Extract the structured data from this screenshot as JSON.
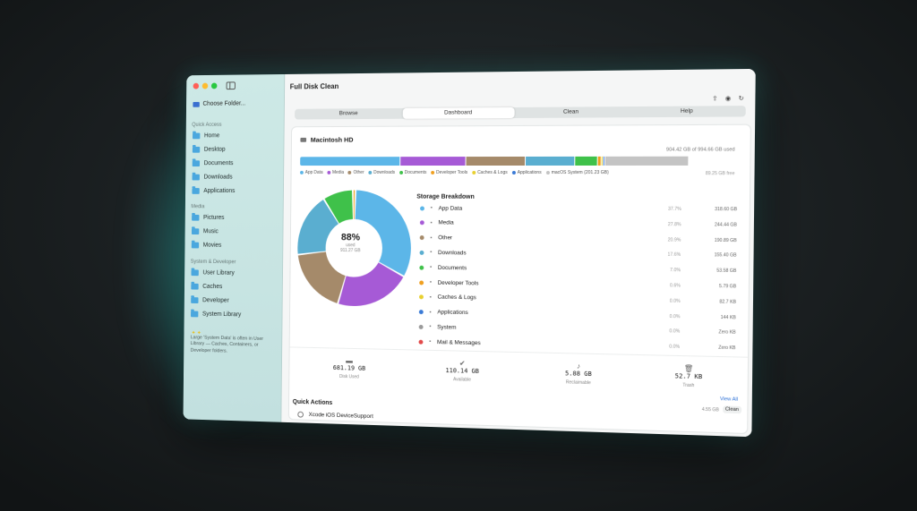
{
  "window": {
    "title": "Full Disk Clean"
  },
  "sidebar": {
    "choose_folder": "Choose Folder...",
    "sections": [
      {
        "label": "Quick Access",
        "items": [
          "Home",
          "Desktop",
          "Documents",
          "Downloads",
          "Applications"
        ]
      },
      {
        "label": "Media",
        "items": [
          "Pictures",
          "Music",
          "Movies"
        ]
      },
      {
        "label": "System & Developer",
        "items": [
          "User Library",
          "Caches",
          "Developer",
          "System Library"
        ]
      }
    ],
    "tip": "Large 'System Data' is often in User Library — Caches, Containers, or Developer folders."
  },
  "tabs": [
    "Browse",
    "Dashboard",
    "Clean",
    "Help"
  ],
  "active_tab": "Dashboard",
  "disk": {
    "name": "Macintosh HD",
    "usage_text": "904.42 GB of 994.66 GB used",
    "free_text": "89.25 GB free",
    "segments": [
      {
        "label": "App Data",
        "color": "#5cb6e8",
        "fraction": 0.245
      },
      {
        "label": "Media",
        "color": "#a65ad6",
        "fraction": 0.155
      },
      {
        "label": "Other",
        "color": "#a58a6a",
        "fraction": 0.14
      },
      {
        "label": "Downloads",
        "color": "#5aaed0",
        "fraction": 0.115
      },
      {
        "label": "Documents",
        "color": "#3fc14a",
        "fraction": 0.05
      },
      {
        "label": "Developer Tools",
        "color": "#f0a020",
        "fraction": 0.006
      },
      {
        "label": "Caches & Logs",
        "color": "#e8d030",
        "fraction": 0.003
      },
      {
        "label": "Applications",
        "color": "#3a7ad6",
        "fraction": 0.002
      },
      {
        "label": "macOS System (201.23 GB)",
        "color": "#c4c4c4",
        "fraction": 0.19
      }
    ]
  },
  "donut": {
    "percent": "88%",
    "label": "used",
    "sub": "911.27 GB"
  },
  "breakdown": {
    "title": "Storage Breakdown",
    "rows": [
      {
        "name": "App Data",
        "color": "#5cb6e8",
        "pct": "37.7%",
        "size": "318.60 GB"
      },
      {
        "name": "Media",
        "color": "#a65ad6",
        "pct": "27.8%",
        "size": "244.44 GB"
      },
      {
        "name": "Other",
        "color": "#a58a6a",
        "pct": "20.9%",
        "size": "190.89 GB"
      },
      {
        "name": "Downloads",
        "color": "#5aaed0",
        "pct": "17.6%",
        "size": "155.40 GB"
      },
      {
        "name": "Documents",
        "color": "#3fc14a",
        "pct": "7.0%",
        "size": "53.58 GB"
      },
      {
        "name": "Developer Tools",
        "color": "#f0a020",
        "pct": "0.6%",
        "size": "5.79 GB"
      },
      {
        "name": "Caches & Logs",
        "color": "#e8d030",
        "pct": "0.0%",
        "size": "82.7 KB"
      },
      {
        "name": "Applications",
        "color": "#3a7ad6",
        "pct": "0.0%",
        "size": "144 KB"
      },
      {
        "name": "System",
        "color": "#9a9a9a",
        "pct": "0.0%",
        "size": "Zero KB"
      },
      {
        "name": "Mail & Messages",
        "color": "#e24a4a",
        "pct": "0.0%",
        "size": "Zero KB"
      }
    ]
  },
  "chart_data": {
    "type": "pie",
    "categories": [
      "App Data",
      "Media",
      "Other",
      "Downloads",
      "Documents",
      "Developer Tools"
    ],
    "values": [
      32.6,
      21.5,
      18.6,
      17.9,
      8.6,
      0.8
    ],
    "colors": [
      "#5cb6e8",
      "#a65ad6",
      "#a58a6a",
      "#5aaed0",
      "#3fc14a",
      "#f0a020"
    ]
  },
  "stats": [
    {
      "value": "681.19 GB",
      "label": "Disk Used",
      "icon": "drive-icon"
    },
    {
      "value": "110.14 GB",
      "label": "Available",
      "icon": "check-icon"
    },
    {
      "value": "5.88 GB",
      "label": "Reclaimable",
      "icon": "bell-icon"
    },
    {
      "value": "52.7 KB",
      "label": "Trash",
      "icon": "trash-icon"
    }
  ],
  "view_all": "View All",
  "quick_actions": {
    "title": "Quick Actions",
    "items": [
      {
        "label": "Xcode iOS DeviceSupport",
        "size": "4.55 GB",
        "action": "Clean"
      }
    ]
  }
}
